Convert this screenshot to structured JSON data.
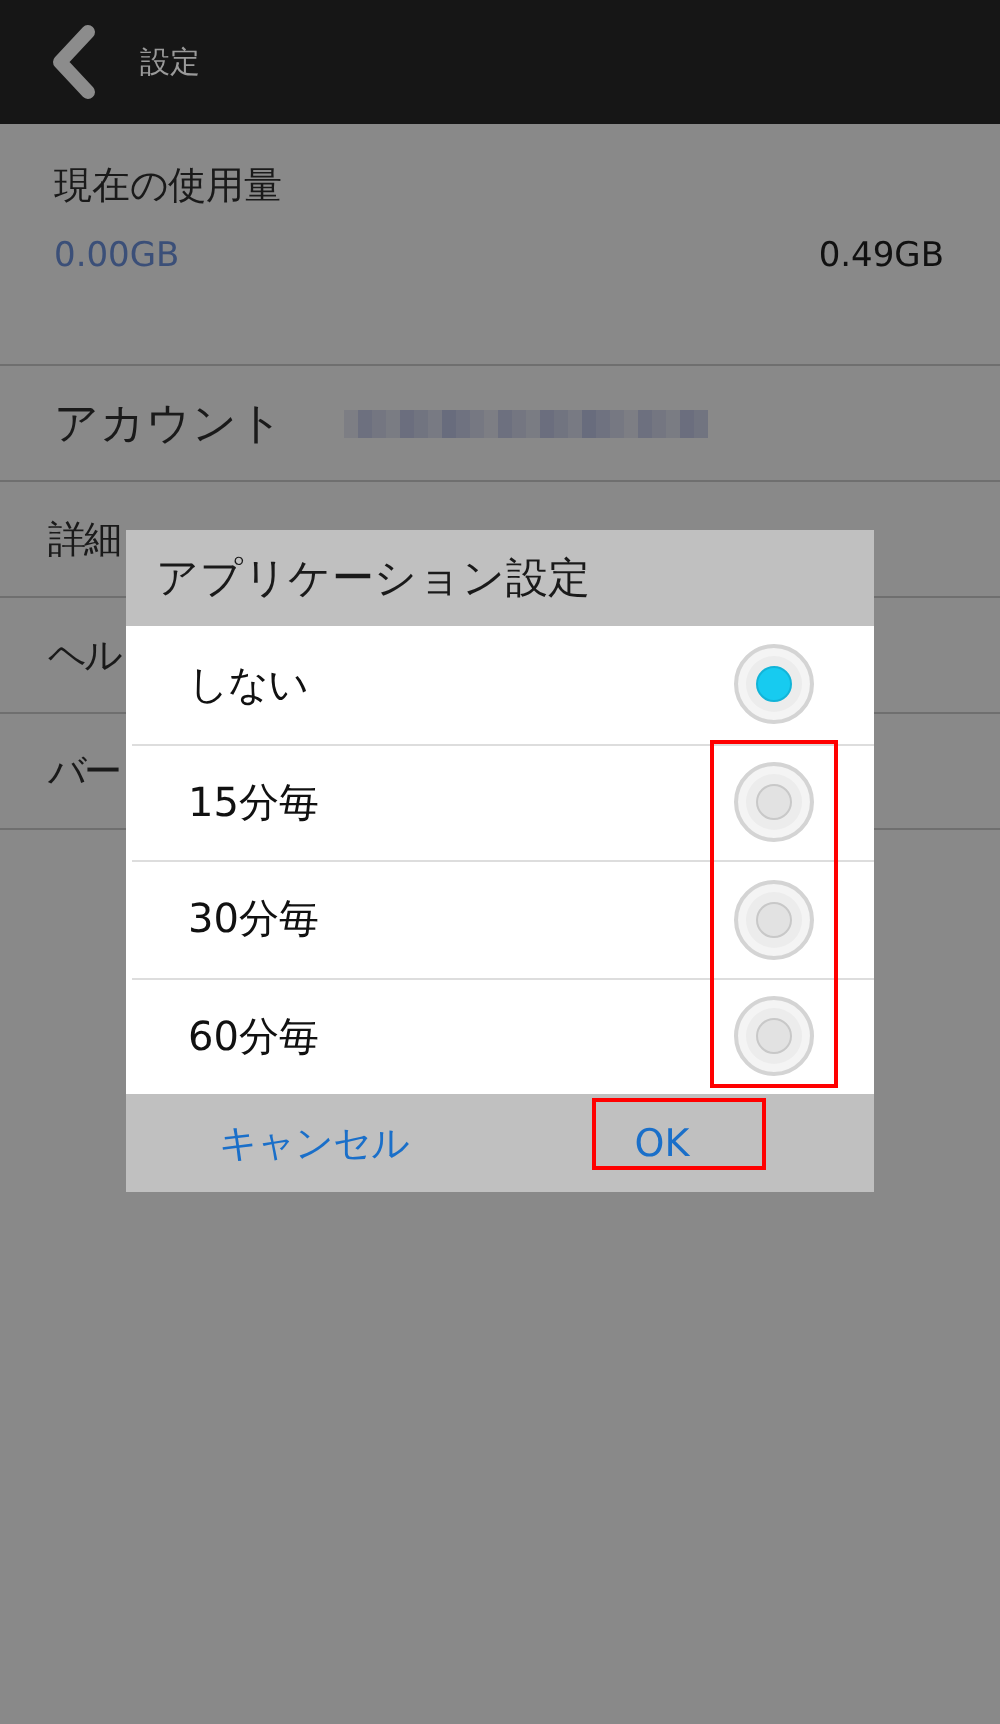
{
  "header": {
    "title": "設定"
  },
  "usage": {
    "label": "現在の使用量",
    "used": "0.00GB",
    "total": "0.49GB"
  },
  "rows": [
    {
      "label": "アカウント",
      "kind": "account"
    },
    {
      "label": "詳細",
      "kind": "plain"
    },
    {
      "label": "ヘル",
      "kind": "plain"
    },
    {
      "label": "バー",
      "kind": "plain"
    }
  ],
  "dialog": {
    "title": "アプリケーション設定",
    "options": [
      {
        "label": "しない",
        "selected": true
      },
      {
        "label": "15分毎",
        "selected": false
      },
      {
        "label": "30分毎",
        "selected": false
      },
      {
        "label": "60分毎",
        "selected": false
      }
    ],
    "buttons": [
      {
        "label": "キャンセル",
        "kind": "cancel"
      },
      {
        "label": "OK",
        "kind": "ok"
      }
    ]
  }
}
